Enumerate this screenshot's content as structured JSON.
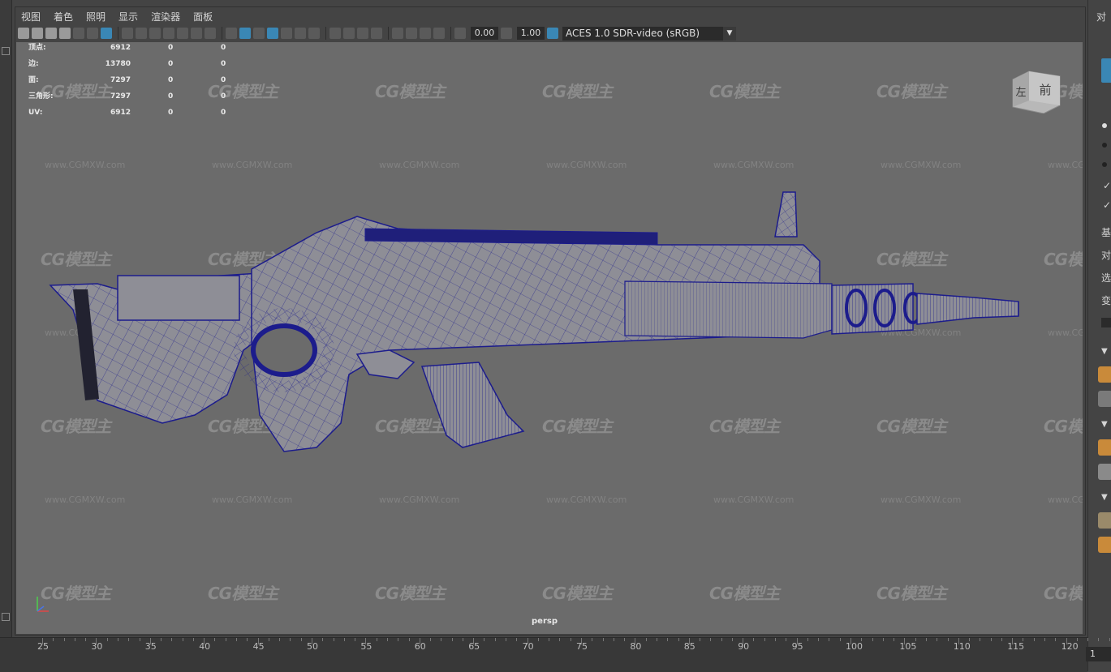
{
  "menu": [
    "视图",
    "着色",
    "照明",
    "显示",
    "渲染器",
    "面板"
  ],
  "toolbar": {
    "exposure_value": "0.00",
    "gamma_value": "1.00",
    "color_management": "ACES 1.0 SDR-video (sRGB)"
  },
  "hud_stats": [
    {
      "label": "顶点:",
      "value": "6912",
      "sel": "0",
      "comp": "0"
    },
    {
      "label": "边:",
      "value": "13780",
      "sel": "0",
      "comp": "0"
    },
    {
      "label": "面:",
      "value": "7297",
      "sel": "0",
      "comp": "0"
    },
    {
      "label": "三角形:",
      "value": "7297",
      "sel": "0",
      "comp": "0"
    },
    {
      "label": "UV:",
      "value": "6912",
      "sel": "0",
      "comp": "0"
    }
  ],
  "viewcube": {
    "left_face": "左",
    "front_face": "前"
  },
  "camera_label": "persp",
  "watermark": {
    "logo": "CG模型主",
    "url": "www.CGMXW.com"
  },
  "right_panel": {
    "title": "对",
    "labels": [
      "基",
      "对",
      "选",
      "变"
    ]
  },
  "timeline": {
    "ticks": [
      "25",
      "30",
      "35",
      "40",
      "45",
      "50",
      "55",
      "60",
      "65",
      "70",
      "75",
      "80",
      "85",
      "90",
      "95",
      "100",
      "105",
      "110",
      "115",
      "120"
    ],
    "current_frame": "1"
  },
  "colors": {
    "viewport_bg": "#6b6b6b",
    "wireframe": "#1c1c8c",
    "mesh_fill": "#8e8e96",
    "ui_bg": "#444444"
  }
}
